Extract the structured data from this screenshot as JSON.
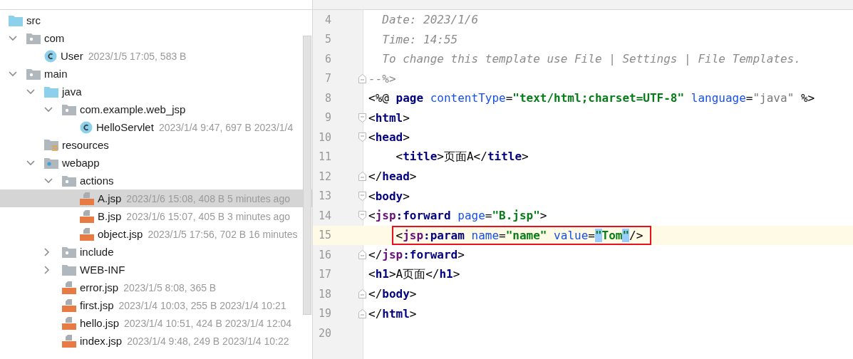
{
  "tree": [
    {
      "name": "src",
      "kind": "source-folder",
      "selected": false,
      "children": [
        {
          "name": "com",
          "kind": "package",
          "expanded": true,
          "selected": false,
          "children": [
            {
              "name": "User",
              "kind": "class",
              "meta": "2023/1/5 17:05, 583 B",
              "selected": false
            }
          ]
        },
        {
          "name": "main",
          "kind": "package",
          "expanded": true,
          "selected": false,
          "children": [
            {
              "name": "java",
              "kind": "source-folder",
              "expanded": true,
              "selected": false,
              "children": [
                {
                  "name": "com.example.web_jsp",
                  "kind": "package",
                  "expanded": true,
                  "selected": false,
                  "children": [
                    {
                      "name": "HelloServlet",
                      "kind": "class",
                      "meta": "2023/1/4 9:47, 697 B 2023/1/4",
                      "selected": false
                    }
                  ]
                }
              ]
            },
            {
              "name": "resources",
              "kind": "resources",
              "selected": false
            },
            {
              "name": "webapp",
              "kind": "web-folder",
              "expanded": true,
              "selected": false,
              "children": [
                {
                  "name": "actions",
                  "kind": "package",
                  "expanded": true,
                  "selected": false,
                  "children": [
                    {
                      "name": "A.jsp",
                      "kind": "jsp",
                      "meta": "2023/1/6 15:08, 408 B 5 minutes ago",
                      "selected": true
                    },
                    {
                      "name": "B.jsp",
                      "kind": "jsp",
                      "meta": "2023/1/6 15:07, 405 B 3 minutes ago",
                      "selected": false
                    },
                    {
                      "name": "object.jsp",
                      "kind": "jsp",
                      "meta": "2023/1/5 17:56, 702 B 16 minutes",
                      "selected": false
                    }
                  ]
                },
                {
                  "name": "include",
                  "kind": "package",
                  "expanded": false,
                  "selected": false
                },
                {
                  "name": "WEB-INF",
                  "kind": "folder",
                  "expanded": false,
                  "selected": false
                },
                {
                  "name": "error.jsp",
                  "kind": "jsp",
                  "meta": "2023/1/5 8:08, 365 B",
                  "selected": false
                },
                {
                  "name": "first.jsp",
                  "kind": "jsp",
                  "meta": "2023/1/4 10:03, 255 B 2023/1/4 10:21",
                  "selected": false
                },
                {
                  "name": "hello.jsp",
                  "kind": "jsp",
                  "meta": "2023/1/4 10:51, 424 B 2023/1/4 12:04",
                  "selected": false
                },
                {
                  "name": "index.jsp",
                  "kind": "jsp",
                  "meta": "2023/1/4 9:48, 249 B 2023/1/4 10:22",
                  "selected": false
                }
              ]
            }
          ]
        }
      ]
    }
  ],
  "editor": {
    "lines": [
      {
        "number": "4",
        "kind": "plain",
        "current": false,
        "boxed": false,
        "tokens": [
          {
            "text": "  Date: 2023/1/6",
            "kind": "comment"
          }
        ]
      },
      {
        "number": "5",
        "kind": "plain",
        "current": false,
        "boxed": false,
        "tokens": [
          {
            "text": "  Time: 14:55",
            "kind": "comment"
          }
        ]
      },
      {
        "number": "6",
        "kind": "plain",
        "current": false,
        "boxed": false,
        "tokens": [
          {
            "text": "  To change this template use File | Settings | File Templates.",
            "kind": "comment"
          }
        ]
      },
      {
        "number": "7",
        "kind": "fold-end",
        "current": false,
        "boxed": false,
        "tokens": [
          {
            "text": "--%>",
            "kind": "comment"
          }
        ]
      },
      {
        "number": "8",
        "kind": "plain",
        "current": false,
        "boxed": false,
        "tokens": [
          {
            "text": "<%@ ",
            "kind": "text"
          },
          {
            "text": "page",
            "kind": "tag"
          },
          {
            "text": " contentType",
            "kind": "attr"
          },
          {
            "text": "=",
            "kind": "text"
          },
          {
            "text": "\"text/html;charset=UTF-8\"",
            "kind": "value"
          },
          {
            "text": " language",
            "kind": "attr"
          },
          {
            "text": "=",
            "kind": "text"
          },
          {
            "text": "\"java\"",
            "kind": "muted"
          },
          {
            "text": " %>",
            "kind": "text"
          }
        ]
      },
      {
        "number": "9",
        "kind": "fold-start",
        "current": false,
        "boxed": false,
        "tokens": [
          {
            "text": "<",
            "kind": "text"
          },
          {
            "text": "html",
            "kind": "tag"
          },
          {
            "text": ">",
            "kind": "text"
          }
        ]
      },
      {
        "number": "10",
        "kind": "fold-start",
        "current": false,
        "boxed": false,
        "tokens": [
          {
            "text": "<",
            "kind": "text"
          },
          {
            "text": "head",
            "kind": "tag"
          },
          {
            "text": ">",
            "kind": "text"
          }
        ]
      },
      {
        "number": "11",
        "kind": "plain",
        "current": false,
        "boxed": false,
        "tokens": [
          {
            "text": "    <",
            "kind": "text"
          },
          {
            "text": "title",
            "kind": "tag"
          },
          {
            "text": ">页面A</",
            "kind": "text"
          },
          {
            "text": "title",
            "kind": "tag"
          },
          {
            "text": ">",
            "kind": "text"
          }
        ]
      },
      {
        "number": "12",
        "kind": "fold-end",
        "current": false,
        "boxed": false,
        "tokens": [
          {
            "text": "</",
            "kind": "text"
          },
          {
            "text": "head",
            "kind": "tag"
          },
          {
            "text": ">",
            "kind": "text"
          }
        ]
      },
      {
        "number": "13",
        "kind": "fold-start",
        "current": false,
        "boxed": false,
        "tokens": [
          {
            "text": "<",
            "kind": "text"
          },
          {
            "text": "body",
            "kind": "tag"
          },
          {
            "text": ">",
            "kind": "text"
          }
        ]
      },
      {
        "number": "14",
        "kind": "fold-start",
        "current": false,
        "boxed": false,
        "tokens": [
          {
            "text": "<",
            "kind": "text"
          },
          {
            "text": "jsp",
            "kind": "ns"
          },
          {
            "text": ":forward",
            "kind": "tag"
          },
          {
            "text": " page",
            "kind": "attr"
          },
          {
            "text": "=",
            "kind": "text"
          },
          {
            "text": "\"B.jsp\"",
            "kind": "value"
          },
          {
            "text": ">",
            "kind": "text"
          }
        ]
      },
      {
        "number": "15",
        "kind": "plain",
        "current": true,
        "boxed": true,
        "tokens": [
          {
            "text": "    <",
            "kind": "text"
          },
          {
            "text": "jsp",
            "kind": "ns"
          },
          {
            "text": ":param",
            "kind": "tag"
          },
          {
            "text": " name",
            "kind": "attr"
          },
          {
            "text": "=",
            "kind": "text"
          },
          {
            "text": "\"name\"",
            "kind": "value"
          },
          {
            "text": " value",
            "kind": "attr"
          },
          {
            "text": "=",
            "kind": "text"
          },
          {
            "text": "\"",
            "kind": "match"
          },
          {
            "text": "Tom",
            "kind": "value"
          },
          {
            "text": "\"",
            "kind": "match"
          },
          {
            "text": "/>",
            "kind": "text"
          }
        ]
      },
      {
        "number": "16",
        "kind": "fold-end",
        "current": false,
        "boxed": false,
        "tokens": [
          {
            "text": "</",
            "kind": "text"
          },
          {
            "text": "jsp",
            "kind": "ns"
          },
          {
            "text": ":forward",
            "kind": "tag"
          },
          {
            "text": ">",
            "kind": "text"
          }
        ]
      },
      {
        "number": "17",
        "kind": "plain",
        "current": false,
        "boxed": false,
        "tokens": [
          {
            "text": "<",
            "kind": "text"
          },
          {
            "text": "h1",
            "kind": "tag"
          },
          {
            "text": ">A页面</",
            "kind": "text"
          },
          {
            "text": "h1",
            "kind": "tag"
          },
          {
            "text": ">",
            "kind": "text"
          }
        ]
      },
      {
        "number": "18",
        "kind": "fold-end",
        "current": false,
        "boxed": false,
        "tokens": [
          {
            "text": "</",
            "kind": "text"
          },
          {
            "text": "body",
            "kind": "tag"
          },
          {
            "text": ">",
            "kind": "text"
          }
        ]
      },
      {
        "number": "19",
        "kind": "fold-end",
        "current": false,
        "boxed": false,
        "tokens": [
          {
            "text": "</",
            "kind": "text"
          },
          {
            "text": "html",
            "kind": "tag"
          },
          {
            "text": ">",
            "kind": "text"
          }
        ]
      },
      {
        "number": "20",
        "kind": "plain",
        "current": false
      }
    ]
  }
}
